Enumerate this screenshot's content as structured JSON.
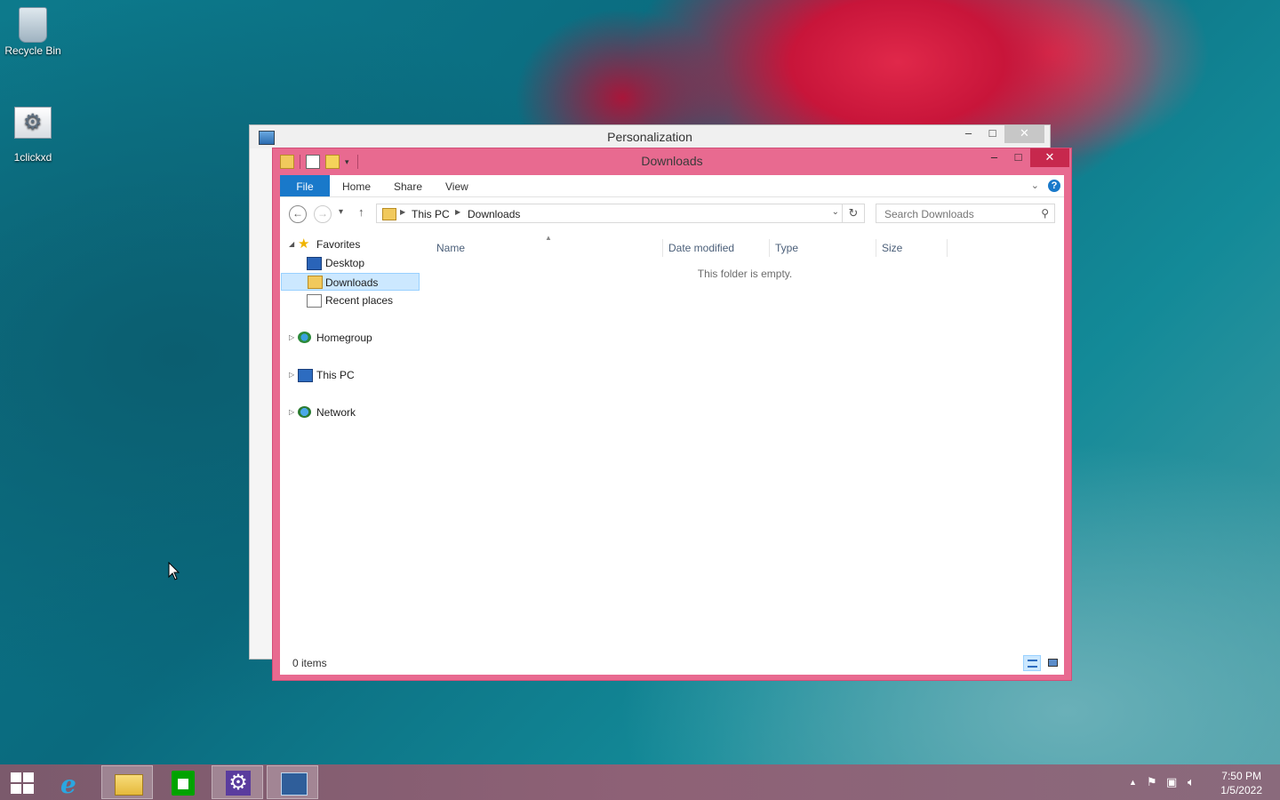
{
  "desktop": {
    "icons": [
      {
        "label": "Recycle Bin"
      },
      {
        "label": "1clickxd"
      }
    ]
  },
  "personalization_window": {
    "title": "Personalization",
    "minimize": "–",
    "maximize": "□",
    "close": "✕"
  },
  "explorer": {
    "title": "Downloads",
    "caption": {
      "minimize": "–",
      "maximize": "□",
      "close": "✕"
    },
    "ribbon_tabs": {
      "file": "File",
      "home": "Home",
      "share": "Share",
      "view": "View"
    },
    "help": "?",
    "address": {
      "segments": [
        "This PC",
        "Downloads"
      ]
    },
    "search": {
      "placeholder": "Search Downloads"
    },
    "nav": {
      "favorites": "Favorites",
      "desktop": "Desktop",
      "downloads": "Downloads",
      "recent": "Recent places",
      "homegroup": "Homegroup",
      "this_pc": "This PC",
      "network": "Network"
    },
    "columns": {
      "name": "Name",
      "date": "Date modified",
      "type": "Type",
      "size": "Size"
    },
    "empty_message": "This folder is empty.",
    "status": {
      "items": "0 items"
    }
  },
  "taskbar": {
    "clock_time": "7:50 PM",
    "clock_date": "1/5/2022"
  },
  "colors": {
    "window_accent": "#e86a90",
    "close_button": "#c7284d",
    "ribbon_file": "#1979ca",
    "selection": "#cce8ff"
  }
}
